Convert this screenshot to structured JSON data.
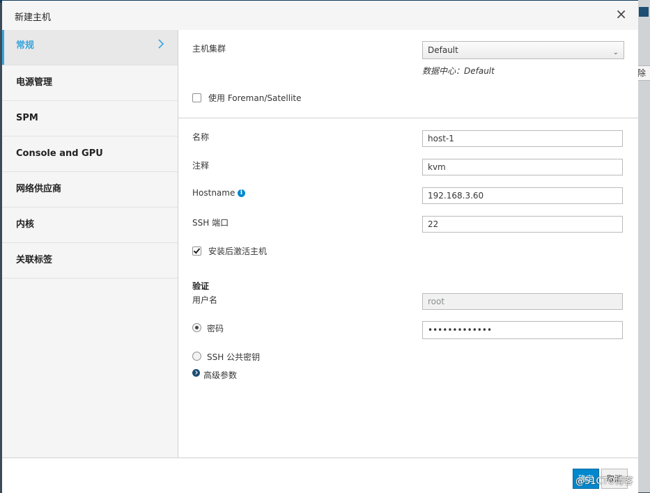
{
  "modal": {
    "title": "新建主机",
    "close_glyph": "×"
  },
  "background": {
    "right_button_label": "除"
  },
  "sidebar": {
    "items": [
      {
        "label": "常规",
        "active": true
      },
      {
        "label": "电源管理"
      },
      {
        "label": "SPM"
      },
      {
        "label": "Console and GPU"
      },
      {
        "label": "网络供应商"
      },
      {
        "label": "内核"
      },
      {
        "label": "关联标签"
      }
    ]
  },
  "general": {
    "cluster_label": "主机集群",
    "cluster_value": "Default",
    "datacenter_hint": "数据中心：Default",
    "foreman_label": "使用 Foreman/Satellite",
    "foreman_checked": false,
    "name_label": "名称",
    "name_value": "host-1",
    "comment_label": "注释",
    "comment_value": "kvm",
    "hostname_label": "Hostname",
    "hostname_value": "192.168.3.60",
    "ssh_port_label": "SSH 端口",
    "ssh_port_value": "22",
    "activate_label": "安装后激活主机",
    "activate_checked": true
  },
  "auth": {
    "section_label": "验证",
    "username_label": "用户名",
    "username_value": "root",
    "password_label": "密码",
    "password_value": "•••••••••••••",
    "password_selected": true,
    "ssh_key_label": "SSH 公共密钥",
    "advanced_label": "高级参数"
  },
  "footer": {
    "ok_label": "确定",
    "cancel_label": "取消"
  },
  "watermark": "@51CTO博客",
  "colors": {
    "accent": "#39a5dc",
    "primary_button": "#0088ce",
    "sidebar_bg": "#f5f5f5"
  }
}
